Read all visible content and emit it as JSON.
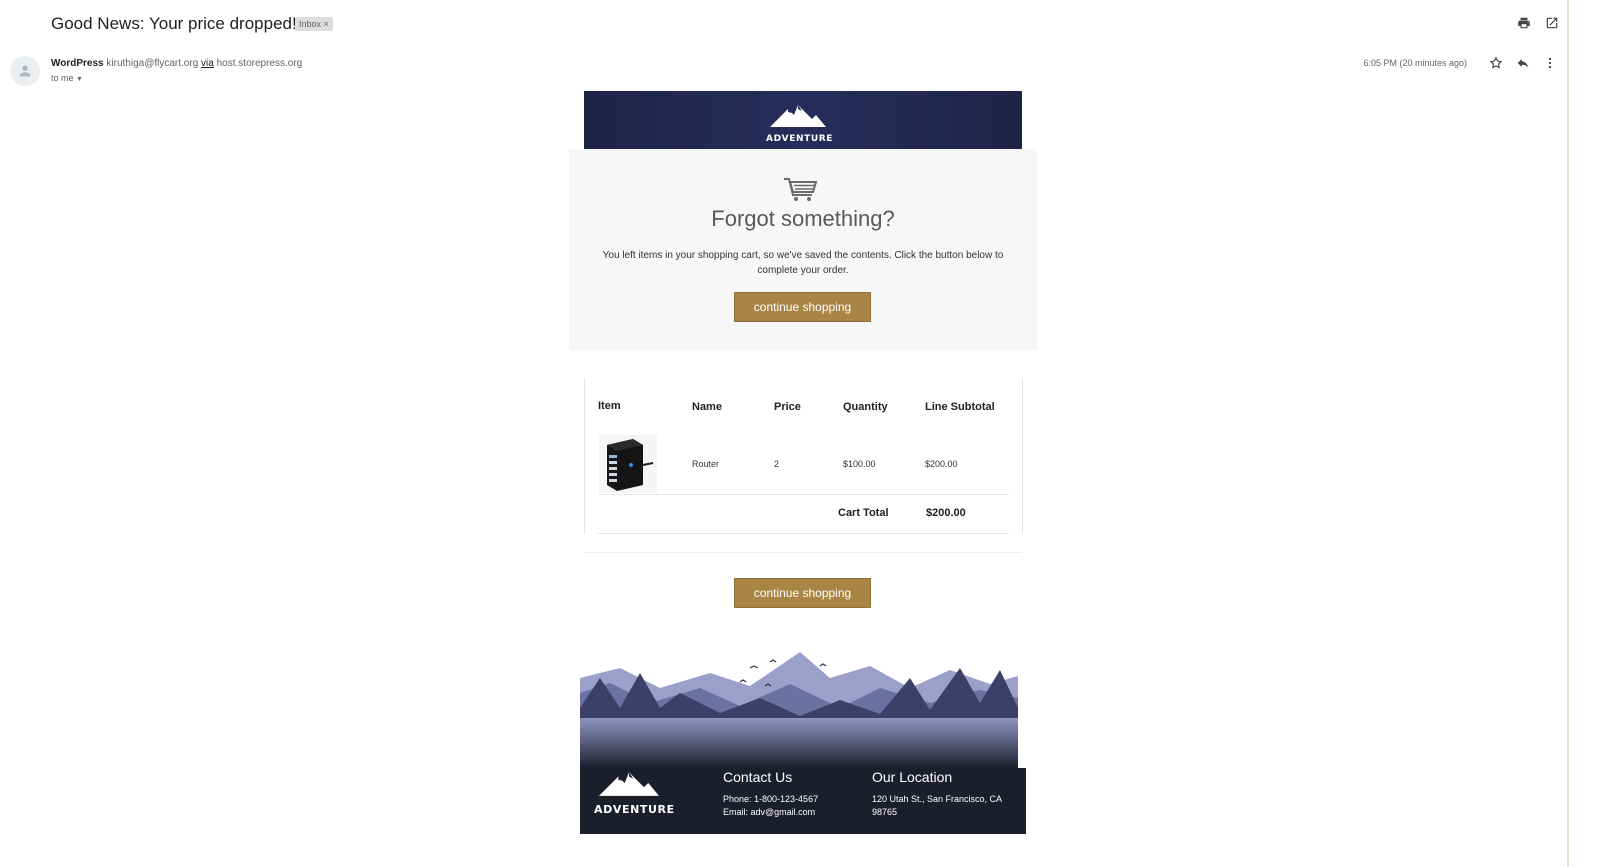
{
  "email": {
    "subject": "Good News: Your price dropped!",
    "label_chip": "Inbox ×",
    "sender_name": "WordPress",
    "sender_email": "kiruthiga@flycart.org",
    "via": "via",
    "via_host": "host.storepress.org",
    "recipient": "to me",
    "timestamp": "6:05 PM (20 minutes ago)"
  },
  "header": {
    "brand": "ADVENTURE"
  },
  "hero": {
    "title": "Forgot something?",
    "text": "You left items in your shopping cart, so we've saved the contents. Click the button below to complete your order.",
    "button": "continue shopping"
  },
  "cart": {
    "headers": [
      "Item",
      "Name",
      "Price",
      "Quantity",
      "Line Subtotal"
    ],
    "rows": [
      {
        "name": "Router",
        "price": "2",
        "quantity": "$100.00",
        "subtotal": "$200.00"
      }
    ],
    "total_label": "Cart Total",
    "total_value": "$200.00"
  },
  "cta": {
    "button": "continue shopping"
  },
  "footer": {
    "brand": "ADVENTURE",
    "contact_title": "Contact Us",
    "phone": "Phone: 1-800-123-4567",
    "email": "Email: adv@gmail.com",
    "location_title": "Our Location",
    "address": "120 Utah St., San Francisco, CA 98765"
  },
  "colors": {
    "button": "#a88445",
    "banner": "#262d5a",
    "footer": "#1d1e2c"
  },
  "icons": [
    "print-icon",
    "open-new-window-icon",
    "star-icon",
    "reply-icon",
    "more-vert-icon",
    "cart-icon",
    "person-icon",
    "dropdown-arrow-icon"
  ]
}
